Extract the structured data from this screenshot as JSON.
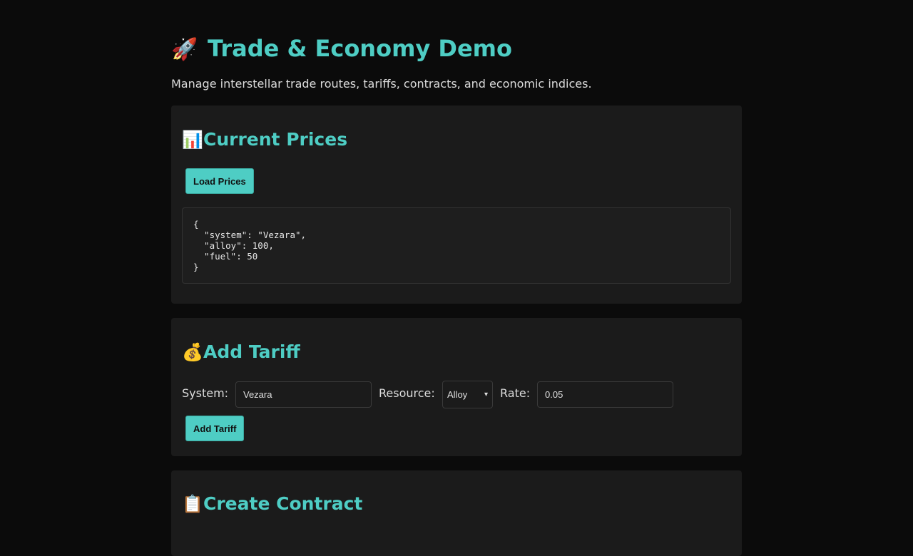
{
  "header": {
    "icon": "rocket-icon",
    "icon_glyph": "🚀",
    "title": "Trade & Economy Demo",
    "subtitle": "Manage interstellar trade routes, tariffs, contracts, and economic indices."
  },
  "prices": {
    "icon": "bar-chart-icon",
    "icon_glyph": "📊",
    "title": "Current Prices",
    "load_label": "Load Prices",
    "output": "{\n  \"system\": \"Vezara\",\n  \"alloy\": 100,\n  \"fuel\": 50\n}"
  },
  "tariff": {
    "icon": "money-bag-icon",
    "icon_glyph": "💰",
    "title": "Add Tariff",
    "system_label": "System:",
    "system_value": "Vezara",
    "resource_label": "Resource:",
    "resource_selected": "Alloy",
    "rate_label": "Rate:",
    "rate_value": "0.05",
    "add_label": "Add Tariff"
  },
  "contract": {
    "icon": "clipboard-icon",
    "icon_glyph": "📋",
    "title": "Create Contract"
  },
  "colors": {
    "background": "#0b0b0b",
    "card": "#1b1b1b",
    "accent": "#4ecdc4"
  }
}
